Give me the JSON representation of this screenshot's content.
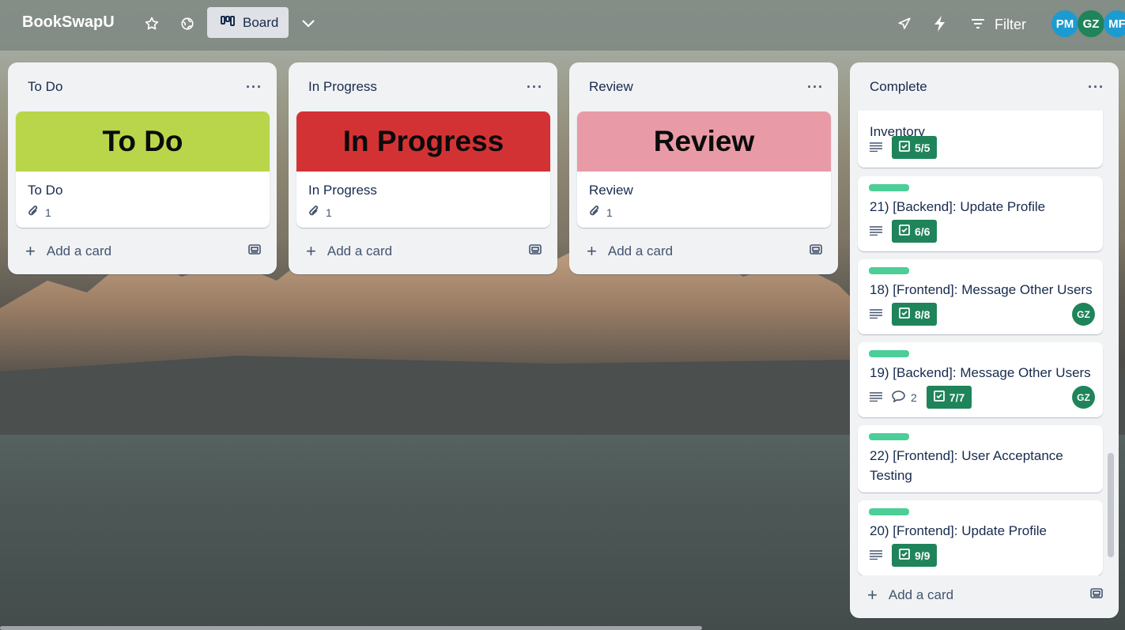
{
  "header": {
    "board_name": "BookSwapU",
    "view_label": "Board",
    "filter_label": "Filter",
    "avatars": [
      {
        "initials": "PM",
        "color": "#1d9bd1"
      },
      {
        "initials": "GZ",
        "color": "#1f845a"
      },
      {
        "initials": "MF",
        "color": "#1d9bd1"
      }
    ]
  },
  "lists": [
    {
      "title": "To Do",
      "cover_text": "To Do",
      "cover_color": "#b9d64b",
      "card_title": "To Do",
      "attachments": "1",
      "add_label": "Add a card"
    },
    {
      "title": "In Progress",
      "cover_text": "In Progress",
      "cover_color": "#d33234",
      "card_title": "In Progress",
      "attachments": "1",
      "add_label": "Add a card"
    },
    {
      "title": "Review",
      "cover_text": "Review",
      "cover_color": "#e89ba6",
      "card_title": "Review",
      "attachments": "1",
      "add_label": "Add a card"
    }
  ],
  "complete": {
    "title": "Complete",
    "add_label": "Add a card",
    "cards": [
      {
        "title": "Inventory",
        "checklist": "5/5"
      },
      {
        "title": "21) [Backend]: Update Profile",
        "checklist": "6/6"
      },
      {
        "title": "18) [Frontend]: Message Other Users",
        "checklist": "8/8",
        "member": "GZ"
      },
      {
        "title": "19) [Backend]: Message Other Users",
        "comments": "2",
        "checklist": "7/7",
        "member": "GZ"
      },
      {
        "title": "22) [Frontend]: User Acceptance Testing"
      },
      {
        "title": "20) [Frontend]: Update Profile",
        "checklist": "9/9"
      }
    ]
  }
}
